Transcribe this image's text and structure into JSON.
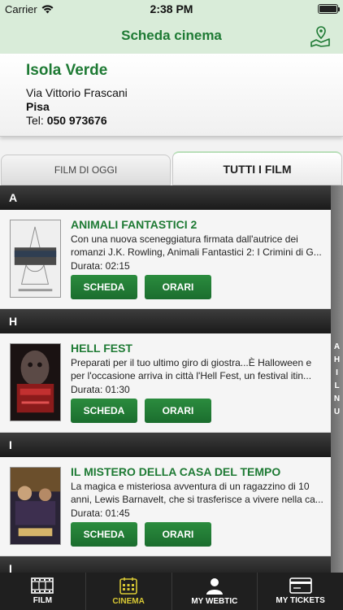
{
  "status": {
    "carrier": "Carrier",
    "time": "2:38 PM"
  },
  "nav": {
    "title": "Scheda cinema",
    "map_icon": "map-pin-icon"
  },
  "cinema": {
    "name": "Isola Verde",
    "street": "Via Vittorio Frascani",
    "city": "Pisa",
    "tel_label": "Tel:",
    "tel_number": "050 973676"
  },
  "tabs": [
    {
      "label": "FILM DI OGGI",
      "active": false
    },
    {
      "label": "TUTTI I FILM",
      "active": true
    }
  ],
  "sections": [
    {
      "letter": "A",
      "films": [
        {
          "title": "ANIMALI FANTASTICI 2",
          "desc_line1": "Con una nuova sceneggiatura firmata dall'autrice dei",
          "desc_line2": "romanzi J.K. Rowling, Animali Fantastici 2: I Crimini di G...",
          "duration": "Durata: 02:15",
          "scheda_label": "SCHEDA",
          "orari_label": "ORARI"
        }
      ]
    },
    {
      "letter": "H",
      "films": [
        {
          "title": "HELL FEST",
          "desc_line1": "Preparati per il tuo ultimo giro di giostra...È Halloween e",
          "desc_line2": "per l'occasione arriva in città l'Hell Fest, un festival itin...",
          "duration": "Durata: 01:30",
          "scheda_label": "SCHEDA",
          "orari_label": "ORARI"
        }
      ]
    },
    {
      "letter": "I",
      "films": [
        {
          "title": "IL MISTERO DELLA CASA DEL TEMPO",
          "desc_line1": "La magica e misteriosa avventura di un ragazzino di 10",
          "desc_line2": "anni, Lewis Barnavelt, che si trasferisce a vivere nella ca...",
          "duration": "Durata: 01:45",
          "scheda_label": "SCHEDA",
          "orari_label": "ORARI"
        }
      ]
    },
    {
      "letter": "I",
      "films": []
    }
  ],
  "index_letters": [
    "A",
    "H",
    "I",
    "L",
    "N",
    "U"
  ],
  "tabbar": [
    {
      "label": "FILM",
      "icon": "film-icon",
      "active": false
    },
    {
      "label": "CINEMA",
      "icon": "cinema-icon",
      "active": true
    },
    {
      "label": "MY WEBTIC",
      "icon": "user-icon",
      "active": false
    },
    {
      "label": "MY TICKETS",
      "icon": "ticket-icon",
      "active": false
    }
  ],
  "colors": {
    "accent": "#1e7a34",
    "nav_bg": "#d9ecd9",
    "active_tab": "#d9c934",
    "tabbar_bg": "#1f1f1f"
  }
}
